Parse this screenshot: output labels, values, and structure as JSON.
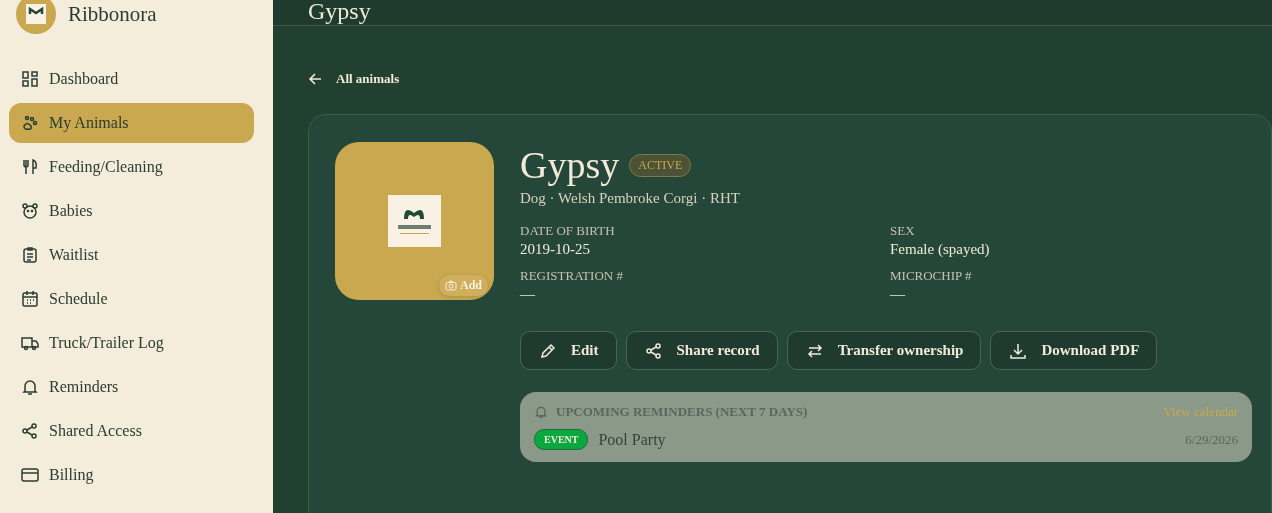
{
  "brand": {
    "name": "Ribbonora"
  },
  "sidebar": {
    "items": [
      {
        "label": "Dashboard",
        "selected": false
      },
      {
        "label": "My Animals",
        "selected": true
      },
      {
        "label": "Feeding/Cleaning",
        "selected": false
      },
      {
        "label": "Babies",
        "selected": false
      },
      {
        "label": "Waitlist",
        "selected": false
      },
      {
        "label": "Schedule",
        "selected": false
      },
      {
        "label": "Truck/Trailer Log",
        "selected": false
      },
      {
        "label": "Reminders",
        "selected": false
      },
      {
        "label": "Shared Access",
        "selected": false
      },
      {
        "label": "Billing",
        "selected": false
      }
    ]
  },
  "header": {
    "title": "Gypsy"
  },
  "back_link": "All animals",
  "animal": {
    "name": "Gypsy",
    "status": "ACTIVE",
    "subtitle": "Dog · Welsh Pembroke Corgi · RHT",
    "photo": {
      "kind": "picture",
      "add_label": "Add"
    },
    "fields": [
      {
        "label": "DATE OF BIRTH",
        "value": "2019-10-25"
      },
      {
        "label": "SEX",
        "value": "Female (spayed)"
      },
      {
        "label": "REGISTRATION #",
        "value": "—"
      },
      {
        "label": "MICROCHIP #",
        "value": "—"
      }
    ],
    "actions": [
      {
        "label": "Edit"
      },
      {
        "label": "Share record"
      },
      {
        "label": "Transfer ownership"
      },
      {
        "label": "Download PDF"
      }
    ]
  },
  "reminders": {
    "title": "UPCOMING REMINDERS (NEXT 7 DAYS)",
    "link": "View calendar",
    "items": [
      {
        "tag": "EVENT",
        "color": "#0aa83f",
        "title": "Pool Party",
        "date": "6/29/2026"
      }
    ]
  }
}
